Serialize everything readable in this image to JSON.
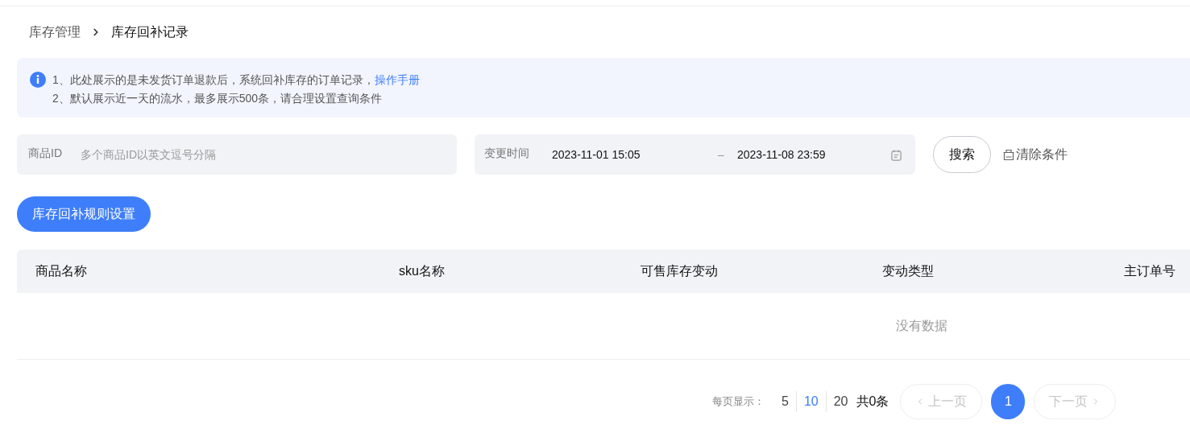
{
  "breadcrumb": [
    {
      "label": "库存管理",
      "current": false
    },
    {
      "label": "库存回补记录",
      "current": true
    }
  ],
  "notice": {
    "lines": [
      "1、此处展示的是未发货订单退款后，系统回补库存的订单记录，",
      "2、默认展示近一天的流水，最多展示500条，请合理设置查询条件"
    ],
    "link": "操作手册"
  },
  "filters": {
    "product_id": {
      "label": "商品ID",
      "placeholder": "多个商品ID以英文逗号分隔"
    },
    "time": {
      "label": "变更时间",
      "start": "2023-11-01 15:05",
      "separator": "–",
      "end": "2023-11-08 23:59"
    },
    "search": "搜索",
    "clear": "清除条件"
  },
  "primary_button": "库存回补规则设置",
  "table": {
    "columns": [
      "商品名称",
      "sku名称",
      "可售库存变动",
      "变动类型",
      "主订单号"
    ],
    "empty": "没有数据"
  },
  "pagination": {
    "page_size_label": "每页显示：",
    "sizes": [
      {
        "label": "5",
        "selected": false
      },
      {
        "label": "10",
        "selected": true
      },
      {
        "label": "20",
        "selected": false
      }
    ],
    "total": "共0条",
    "prev": {
      "label": "上一页",
      "disabled": true
    },
    "pages": [
      {
        "label": "1",
        "selected": true
      }
    ],
    "next": {
      "label": "下一页",
      "disabled": true
    }
  }
}
